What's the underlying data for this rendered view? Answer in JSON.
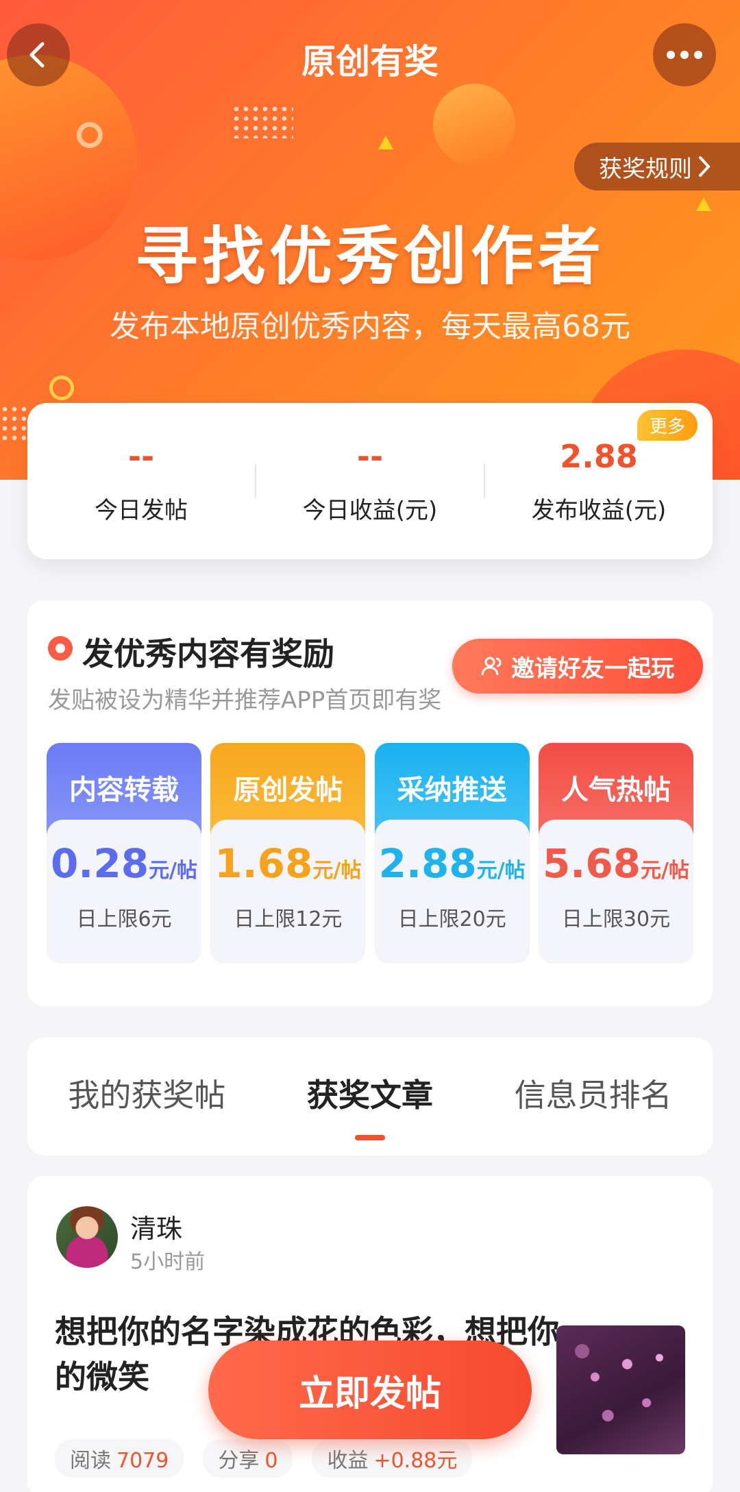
{
  "nav": {
    "title": "原创有奖",
    "rules_label": "获奖规则"
  },
  "hero": {
    "title": "寻找优秀创作者",
    "subtitle": "发布本地原创优秀内容，每天最高68元"
  },
  "stats": {
    "items": [
      {
        "value": "--",
        "label": "今日发帖"
      },
      {
        "value": "--",
        "label": "今日收益(元)"
      },
      {
        "value": "2.88",
        "label": "发布收益(元)"
      }
    ],
    "more_badge": "更多"
  },
  "reward": {
    "title": "发优秀内容有奖励",
    "subtitle": "发贴被设为精华并推荐APP首页即有奖",
    "invite_label": "邀请好友一起玩",
    "tiers": [
      {
        "name": "内容转载",
        "price": "0.28",
        "unit": "元/帖",
        "limit": "日上限6元",
        "color": "#5b6cf0"
      },
      {
        "name": "原创发帖",
        "price": "1.68",
        "unit": "元/帖",
        "limit": "日上限12元",
        "color": "#f7a21b"
      },
      {
        "name": "采纳推送",
        "price": "2.88",
        "unit": "元/帖",
        "limit": "日上限20元",
        "color": "#1fb3ee"
      },
      {
        "name": "人气热帖",
        "price": "5.68",
        "unit": "元/帖",
        "limit": "日上限30元",
        "color": "#f05a4a"
      }
    ]
  },
  "tabs": [
    {
      "label": "我的获奖帖"
    },
    {
      "label": "获奖文章"
    },
    {
      "label": "信息员排名"
    }
  ],
  "post": {
    "author": "清珠",
    "time": "5小时前",
    "title": "想把你的名字染成花的色彩，想把你的微笑",
    "metrics": [
      {
        "label": "阅读",
        "value": "7079"
      },
      {
        "label": "分享",
        "value": "0"
      },
      {
        "label": "收益",
        "value": "+0.88元"
      }
    ]
  },
  "fab_label": "立即发帖"
}
